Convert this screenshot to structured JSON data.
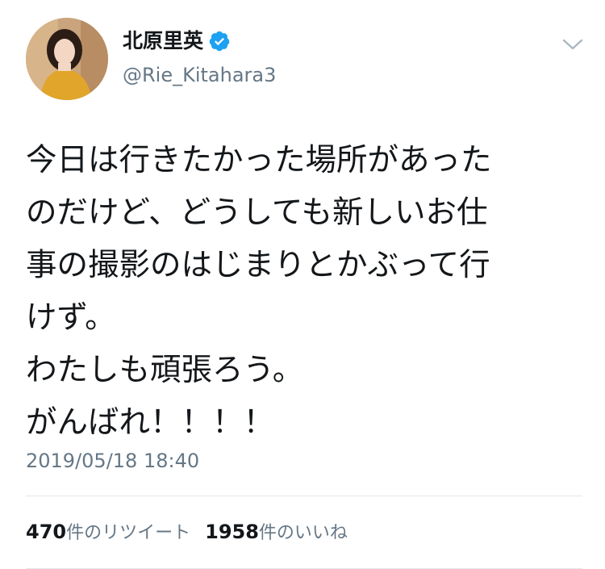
{
  "user": {
    "display_name": "北原里英",
    "handle": "@Rie_Kitahara3",
    "verified": true,
    "verified_color": "#1da1f2"
  },
  "tweet": {
    "lines": [
      "今日は行きたかった場所があった",
      "のだけど、どうしても新しいお仕",
      "事の撮影のはじまりとかぶって行",
      "けず。",
      "わたしも頑張ろう。",
      "がんばれ！！！！"
    ],
    "timestamp": "2019/05/18 18:40"
  },
  "stats": {
    "retweets_count": "470",
    "retweets_label": "件のリツイート",
    "likes_count": "1958",
    "likes_label": "件のいいね"
  },
  "icons": {
    "verified": "verified-badge-icon",
    "caret": "chevron-down-icon"
  },
  "colors": {
    "text": "#14171a",
    "secondary": "#657786",
    "divider": "#e1e8ed"
  }
}
